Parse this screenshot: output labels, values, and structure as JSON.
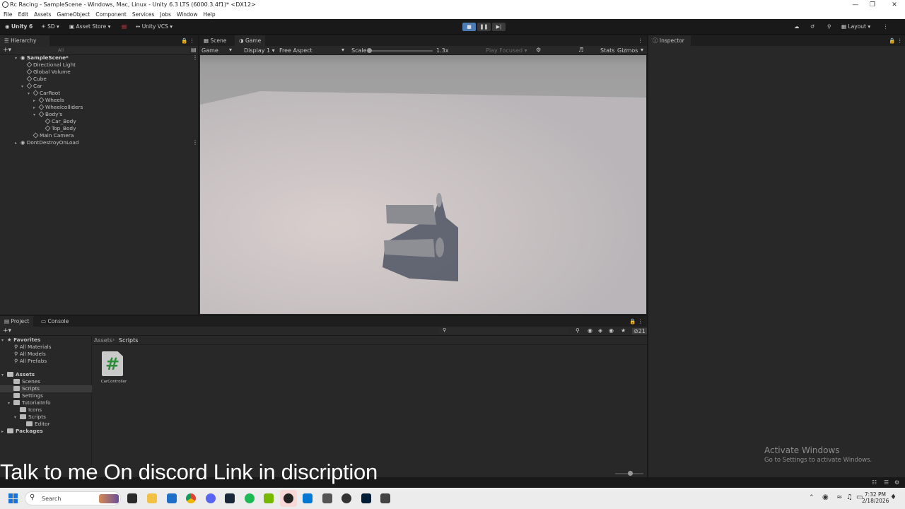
{
  "window": {
    "title": "Rc Racing - SampleScene - Windows, Mac, Linux - Unity 6.3 LTS (6000.3.4f1)* <DX12>"
  },
  "menu": [
    "File",
    "Edit",
    "Assets",
    "GameObject",
    "Component",
    "Services",
    "Jobs",
    "Window",
    "Help"
  ],
  "toolbar": {
    "unity": "Unity 6",
    "sd": "SD",
    "asset_store": "Asset Store",
    "vcs": "Unity VCS",
    "layout": "Layout"
  },
  "hierarchy": {
    "tab": "Hierarchy",
    "search_placeholder": "All",
    "items": [
      {
        "label": "SampleScene*"
      },
      {
        "label": "Directional Light"
      },
      {
        "label": "Global Volume"
      },
      {
        "label": "Cube"
      },
      {
        "label": "Car"
      },
      {
        "label": "CarRoot"
      },
      {
        "label": "Wheels"
      },
      {
        "label": "Wheelcolliders"
      },
      {
        "label": "Body's"
      },
      {
        "label": "Car_Body"
      },
      {
        "label": "Top_Body"
      },
      {
        "label": "Main Camera"
      },
      {
        "label": "DontDestroyOnLoad"
      }
    ]
  },
  "scene_tabs": {
    "scene": "Scene",
    "game": "Game"
  },
  "game_toolbar": {
    "mode": "Game",
    "display": "Display 1",
    "aspect": "Free Aspect",
    "scale_label": "Scale",
    "scale_value": "1.3x",
    "play_focused": "Play Focused",
    "stats": "Stats",
    "gizmos": "Gizmos"
  },
  "inspector": {
    "tab": "Inspector"
  },
  "project": {
    "tab_project": "Project",
    "tab_console": "Console",
    "count": "21",
    "breadcrumb_root": "Assets",
    "breadcrumb_current": "Scripts",
    "favorites_label": "Favorites",
    "favorites": [
      "All Materials",
      "All Models",
      "All Prefabs"
    ],
    "assets_label": "Assets",
    "folders": [
      "Scenes",
      "Scripts",
      "Settings",
      "TutorialInfo",
      "Icons",
      "Scripts",
      "Editor"
    ],
    "packages_label": "Packages",
    "asset_items": [
      {
        "name": "CarController",
        "icon": "csharp-script-icon"
      }
    ]
  },
  "activate_windows": {
    "line1": "Activate Windows",
    "line2": "Go to Settings to activate Windows."
  },
  "caption": "Talk to me On discord Link in discription",
  "taskbar": {
    "search_placeholder": "Search",
    "time": "7:32 PM",
    "date": "2/18/2026"
  },
  "colors": {
    "panel_bg": "#282828",
    "editor_bg": "#191919",
    "selection": "#2c5d87",
    "game_floor": "#c9c2c2",
    "script_icon_green": "#2e8b3a"
  }
}
